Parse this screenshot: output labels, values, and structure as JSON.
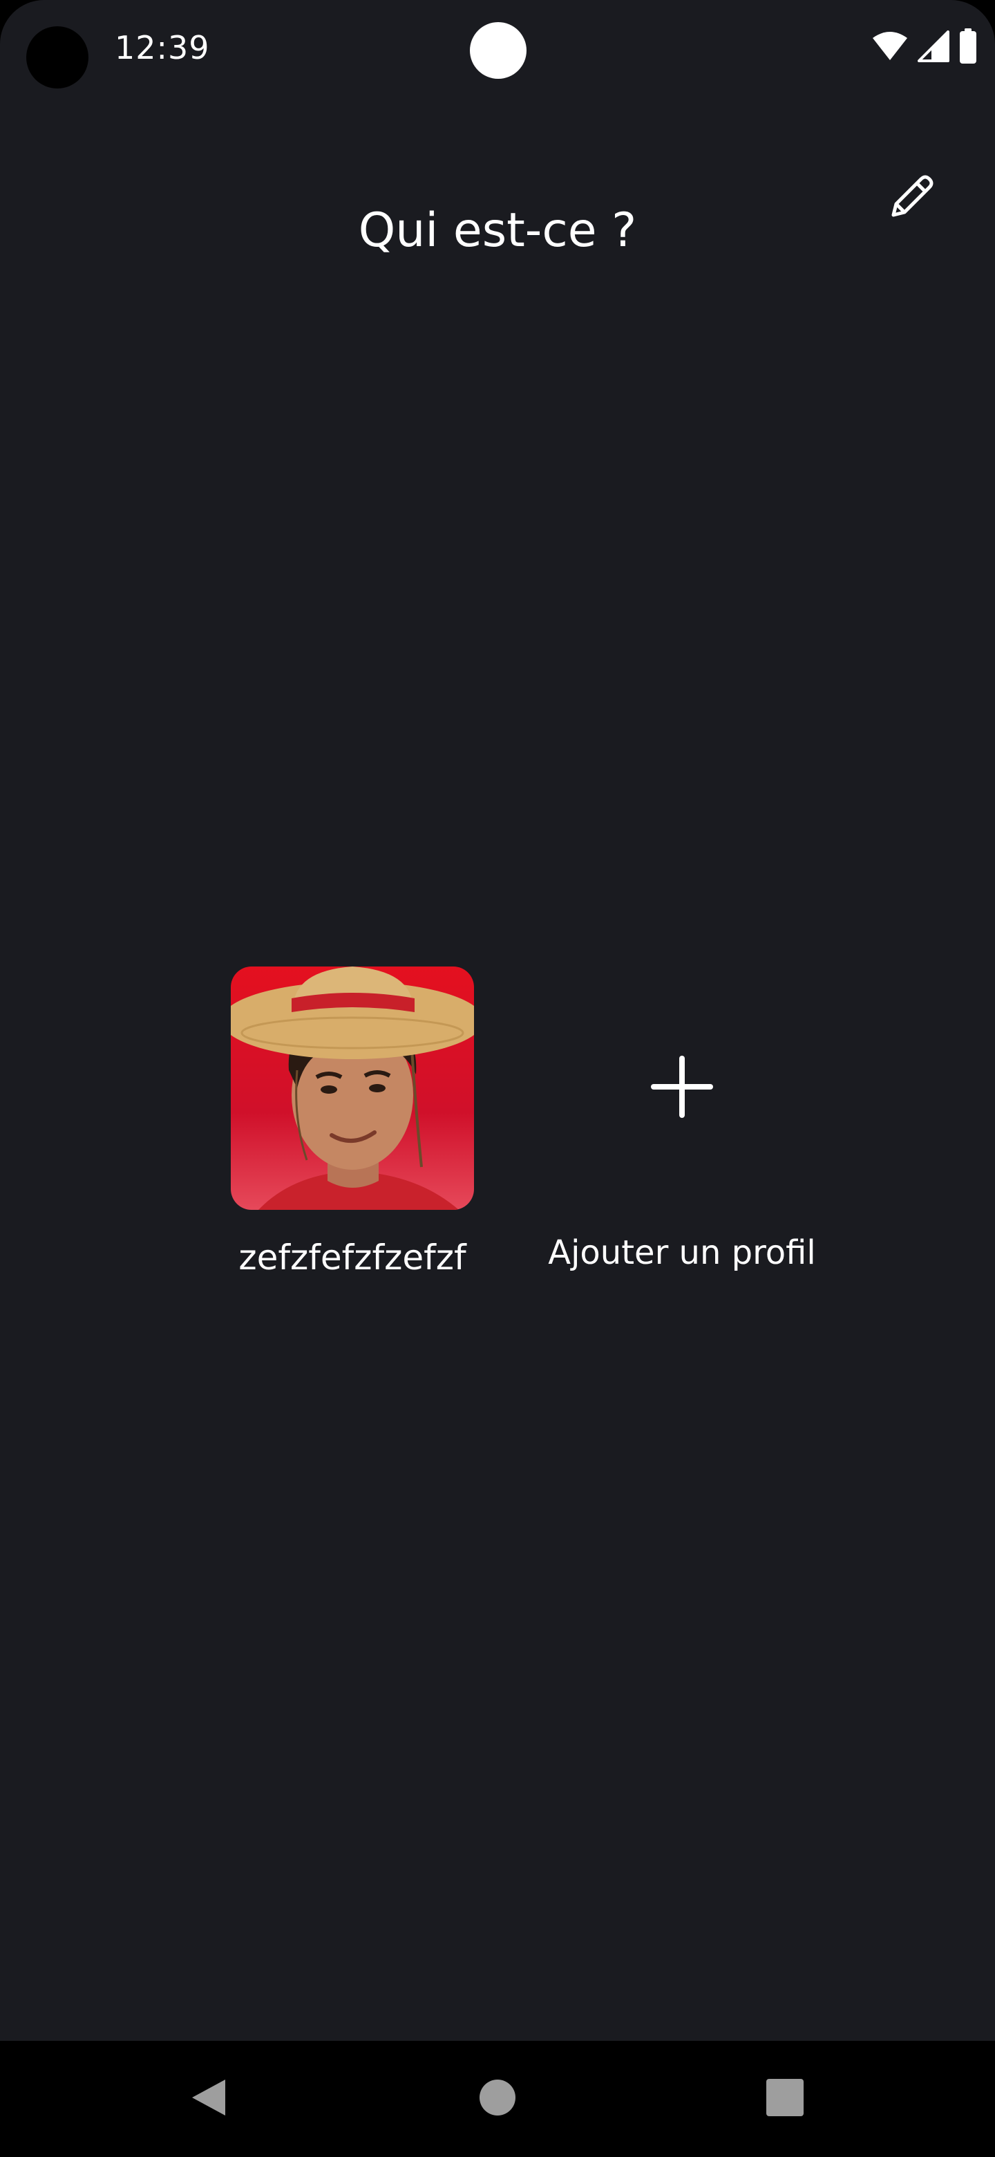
{
  "status_bar": {
    "time": "12:39",
    "icons": [
      "wifi-icon",
      "signal-icon",
      "battery-icon"
    ]
  },
  "header": {
    "title": "Qui est-ce ?",
    "edit_icon": "pencil-icon"
  },
  "profiles": [
    {
      "name": "zefzfefzfzefzf",
      "avatar": "avatar-straw-hat"
    }
  ],
  "add_profile": {
    "label": "Ajouter un profil",
    "icon": "plus-icon"
  },
  "nav_bar": {
    "icons": [
      "back-icon",
      "home-icon",
      "recents-icon"
    ]
  },
  "colors": {
    "background": "#1a1b20",
    "text": "#ffffff",
    "avatar_background": "#e4101f",
    "nav_background": "#000000"
  }
}
